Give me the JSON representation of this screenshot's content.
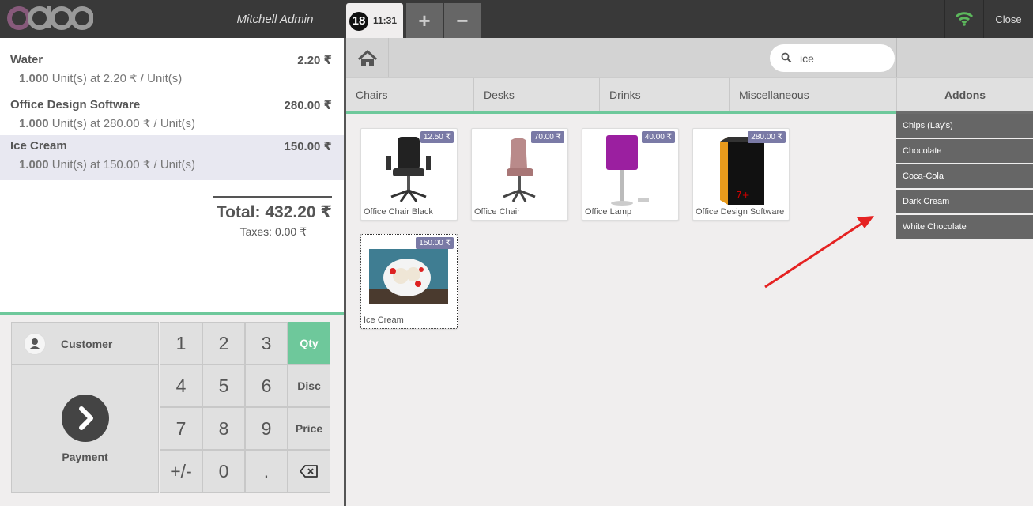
{
  "header": {
    "logo_text": "odoo",
    "user": "Mitchell Admin",
    "order_badge": "18",
    "order_time": "11:31",
    "add_order_glyph": "+",
    "remove_order_glyph": "−",
    "close_label": "Close",
    "wifi_icon": "wifi-icon",
    "wifi_color": "#5cb85c"
  },
  "order": {
    "lines": [
      {
        "name": "Water",
        "price": "2.20 ₹",
        "qty": "1.000",
        "info": " Unit(s) at 2.20 ₹ / Unit(s)"
      },
      {
        "name": "Office Design Software",
        "price": "280.00 ₹",
        "qty": "1.000",
        "info": " Unit(s) at 280.00 ₹ / Unit(s)"
      },
      {
        "name": "Ice Cream",
        "price": "150.00 ₹",
        "qty": "1.000",
        "info": " Unit(s) at 150.00 ₹ / Unit(s)"
      }
    ],
    "total": "Total: 432.20 ₹",
    "taxes": "Taxes: 0.00 ₹"
  },
  "controls": {
    "customer": "Customer",
    "payment": "Payment",
    "keys": [
      "1",
      "2",
      "3",
      "4",
      "5",
      "6",
      "7",
      "8",
      "9",
      "+/-",
      "0",
      "."
    ],
    "modes": [
      "Qty",
      "Disc",
      "Price"
    ],
    "active_mode": "Qty",
    "accent": "#6ec89b"
  },
  "search": {
    "value": "ice"
  },
  "categories": [
    "Chairs",
    "Desks",
    "Drinks",
    "Miscellaneous"
  ],
  "products": [
    {
      "name": "Office Chair Black",
      "price": "12.50 ₹"
    },
    {
      "name": "Office Chair",
      "price": "70.00 ₹"
    },
    {
      "name": "Office Lamp",
      "price": "40.00 ₹"
    },
    {
      "name": "Office Design Software",
      "price": "280.00 ₹"
    },
    {
      "name": "Ice Cream",
      "price": "150.00 ₹"
    }
  ],
  "addons": {
    "title": "Addons",
    "items": [
      "Chips (Lay's)",
      "Chocolate",
      "Coca-Cola",
      "Dark Cream",
      "White Chocolate"
    ]
  }
}
